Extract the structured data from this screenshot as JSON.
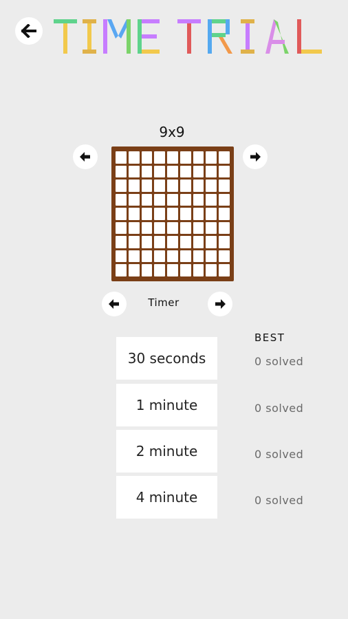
{
  "header": {
    "title_word1": "TIME",
    "title_word2": "TRIAL"
  },
  "board": {
    "size_label": "9x9",
    "rows": 9,
    "cols": 9
  },
  "timer": {
    "label": "Timer"
  },
  "best": {
    "header": "BEST"
  },
  "options": [
    {
      "label": "30 seconds",
      "best": "0 solved"
    },
    {
      "label": "1 minute",
      "best": "0 solved"
    },
    {
      "label": "2 minute",
      "best": "0 solved"
    },
    {
      "label": "4 minute",
      "best": "0 solved"
    }
  ],
  "colors": {
    "background": "#ececec",
    "board_frame": "#7a3f17",
    "title_letters": [
      "#5fd38c",
      "#f2c94c",
      "#e05a5a",
      "#c77dff",
      "#55a9f0",
      "#f2994a",
      "#7cd36a",
      "#d98ee8",
      "#5aa7f2"
    ]
  },
  "icons": {
    "back": "arrow-left-icon",
    "prev": "arrow-left-icon",
    "next": "arrow-right-icon"
  }
}
